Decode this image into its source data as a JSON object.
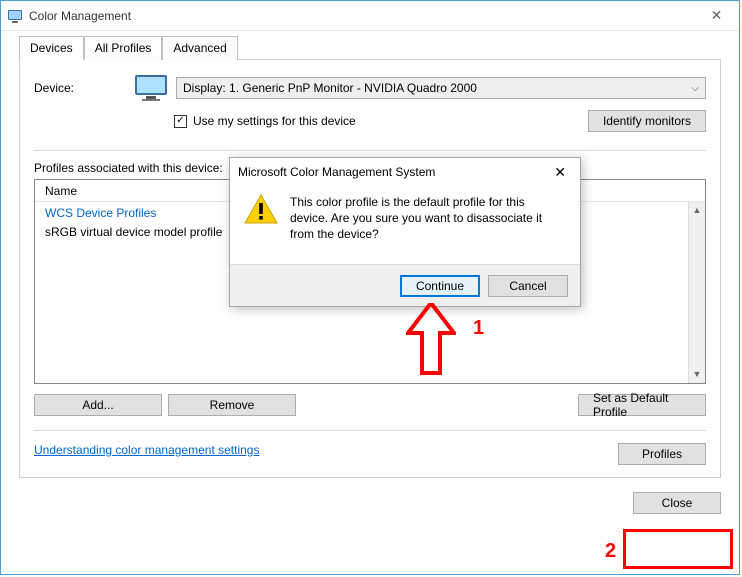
{
  "window": {
    "title": "Color Management"
  },
  "tabs": {
    "devices": "Devices",
    "all_profiles": "All Profiles",
    "advanced": "Advanced"
  },
  "device": {
    "label": "Device:",
    "selected": "Display: 1. Generic PnP Monitor - NVIDIA Quadro 2000",
    "use_settings": "Use my settings for this device",
    "identify": "Identify monitors"
  },
  "profiles": {
    "assoc_label": "Profiles associated with this device:",
    "col_name": "Name",
    "group": "WCS Device Profiles",
    "item0": "sRGB virtual device model profile"
  },
  "buttons": {
    "add": "Add...",
    "remove": "Remove",
    "set_default": "Set as Default Profile",
    "profiles": "Profiles",
    "close": "Close"
  },
  "link": {
    "understand": "Understanding color management settings"
  },
  "dialog": {
    "title": "Microsoft Color Management System",
    "message": "This color profile is the default profile for this device. Are you sure you want to disassociate it from the device?",
    "continue": "Continue",
    "cancel": "Cancel"
  },
  "annotation": {
    "n1": "1",
    "n2": "2"
  }
}
